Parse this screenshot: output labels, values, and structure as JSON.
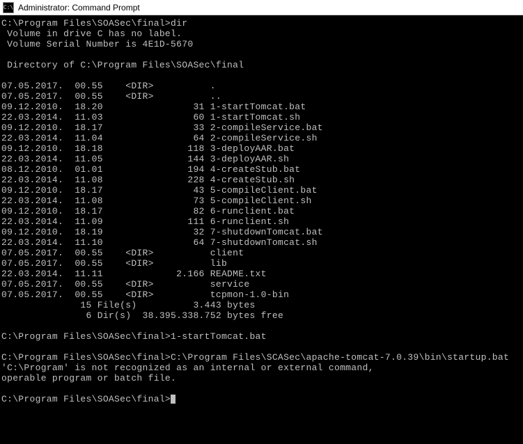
{
  "window": {
    "title": "Administrator: Command Prompt",
    "icon_label": "C:\\"
  },
  "terminal": {
    "prompt1": "C:\\Program Files\\SOASec\\final>dir",
    "vol_label": " Volume in drive C has no label.",
    "vol_serial": " Volume Serial Number is 4E1D-5670",
    "blank": "",
    "dir_of": " Directory of C:\\Program Files\\SOASec\\final",
    "rows": [
      "07.05.2017.  00.55    <DIR>          .",
      "07.05.2017.  00.55    <DIR>          ..",
      "09.12.2010.  18.20                31 1-startTomcat.bat",
      "22.03.2014.  11.03                60 1-startTomcat.sh",
      "09.12.2010.  18.17                33 2-compileService.bat",
      "22.03.2014.  11.04                64 2-compileService.sh",
      "09.12.2010.  18.18               118 3-deployAAR.bat",
      "22.03.2014.  11.05               144 3-deployAAR.sh",
      "08.12.2010.  01.01               194 4-createStub.bat",
      "22.03.2014.  11.08               228 4-createStub.sh",
      "09.12.2010.  18.17                43 5-compileClient.bat",
      "22.03.2014.  11.08                73 5-compileClient.sh",
      "09.12.2010.  18.17                82 6-runclient.bat",
      "22.03.2014.  11.09               111 6-runclient.sh",
      "09.12.2010.  18.19                32 7-shutdownTomcat.bat",
      "22.03.2014.  11.10                64 7-shutdownTomcat.sh",
      "07.05.2017.  00.55    <DIR>          client",
      "07.05.2017.  00.55    <DIR>          lib",
      "22.03.2014.  11.11             2.166 README.txt",
      "07.05.2017.  00.55    <DIR>          service",
      "07.05.2017.  00.55    <DIR>          tcpmon-1.0-bin"
    ],
    "summary1": "              15 File(s)          3.443 bytes",
    "summary2": "               6 Dir(s)  38.395.338.752 bytes free",
    "prompt2": "C:\\Program Files\\SOASec\\final>1-startTomcat.bat",
    "prompt3": "C:\\Program Files\\SOASec\\final>C:\\Program Files\\SCASec\\apache-tomcat-7.0.39\\bin\\startup.bat",
    "error1": "'C:\\Program' is not recognized as an internal or external command,",
    "error2": "operable program or batch file.",
    "prompt4": "C:\\Program Files\\SOASec\\final>"
  }
}
